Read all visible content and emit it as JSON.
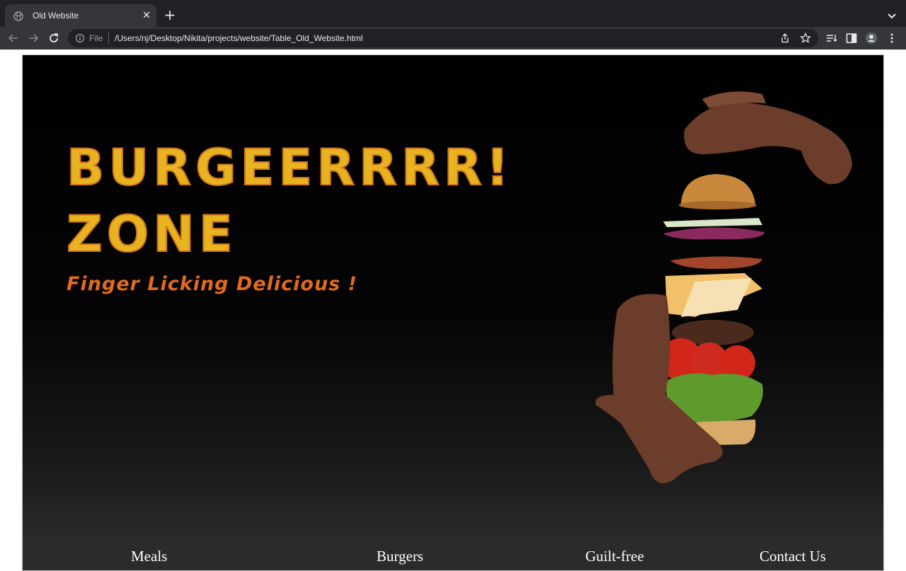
{
  "browser": {
    "tab_title": "Old Website",
    "scheme_label": "File",
    "url": "/Users/nj/Desktop/Nikita/projects/website/Table_Old_Website.html"
  },
  "hero": {
    "headline_line1": "BURGEERRRR!",
    "headline_line2": "ZONE",
    "tagline": "Finger Licking Delicious !"
  },
  "nav": {
    "items": [
      {
        "label": "Meals"
      },
      {
        "label": "Burgers"
      },
      {
        "label": "Guilt-free"
      },
      {
        "label": "Contact Us"
      }
    ]
  },
  "colors": {
    "headline": "#e7b321",
    "headline_outline": "#d0741b",
    "tagline": "#e06a1e",
    "nav_bar": "#2b2b2b"
  }
}
